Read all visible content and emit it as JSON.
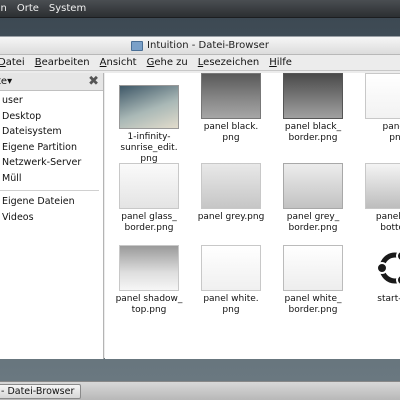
{
  "top_panel": {
    "menus": [
      "gen",
      "Orte",
      "System"
    ]
  },
  "window": {
    "title": "Intuition - Datei-Browser",
    "menu": [
      {
        "label": "atei",
        "ul": "D"
      },
      {
        "label": "earbeiten",
        "ul": "B"
      },
      {
        "label": "nsicht",
        "ul": "A"
      },
      {
        "label": "ehe zu",
        "ul": "G"
      },
      {
        "label": "esezeichen",
        "ul": "L"
      },
      {
        "label": "ilfe",
        "ul": "H"
      }
    ]
  },
  "sidebar": {
    "header_label": "te▾",
    "close_glyph": "✖",
    "places": [
      "user",
      "Desktop",
      "Dateisystem",
      "Eigene Partition",
      "Netzwerk-Server",
      "Müll"
    ],
    "bookmarks": [
      "Eigene Dateien",
      "Videos"
    ]
  },
  "files": [
    {
      "name": "1-infinity-\nsunrise_edit.\npng",
      "icon": "image-thumbnail"
    },
    {
      "name": "panel black.\npng",
      "icon": "image-thumbnail"
    },
    {
      "name": "panel black_\nborder.png",
      "icon": "image-thumbnail"
    },
    {
      "name": "panel\npn",
      "icon": "image-thumbnail"
    },
    {
      "name": "panel glass_\nborder.png",
      "icon": "image-thumbnail"
    },
    {
      "name": "panel grey.png",
      "icon": "image-thumbnail"
    },
    {
      "name": "panel grey_\nborder.png",
      "icon": "image-thumbnail"
    },
    {
      "name": "panel sh\nbotton",
      "icon": "image-thumbnail"
    },
    {
      "name": "panel shadow_\ntop.png",
      "icon": "image-thumbnail"
    },
    {
      "name": "panel white.\npng",
      "icon": "image-thumbnail"
    },
    {
      "name": "panel white_\nborder.png",
      "icon": "image-thumbnail"
    },
    {
      "name": "start-he",
      "icon": "ubuntu-logo-thumbnail"
    }
  ],
  "taskbar": {
    "window_button": "- Datei-Browser"
  }
}
